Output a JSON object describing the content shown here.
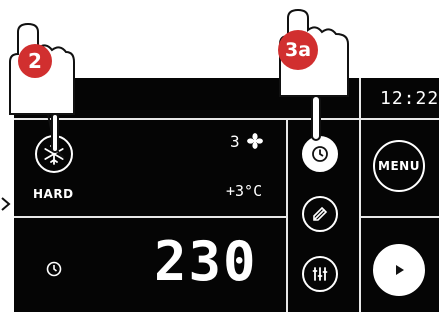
{
  "status": {
    "time": "12:22",
    "fan_level": "3",
    "temperature": "+3°C",
    "mode_label": "HARD",
    "countdown": "230"
  },
  "controls": {
    "menu_label": "MENU"
  },
  "callouts": {
    "step_a": "2",
    "step_b": "3a"
  },
  "colors": {
    "panel_bg": "#050505",
    "callout_red": "#d12f2f",
    "text": "#ffffff"
  },
  "icons": [
    "snowflake-icon",
    "fan-icon",
    "clock-icon",
    "probe-icon",
    "sliders-icon",
    "play-icon",
    "hand-icon",
    "arrow-icon"
  ]
}
